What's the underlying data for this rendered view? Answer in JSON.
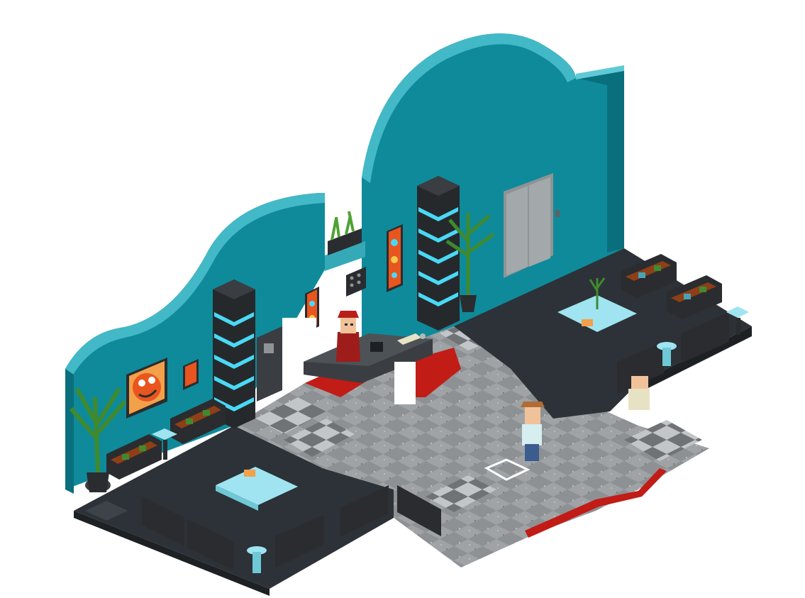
{
  "scene": {
    "type": "isometric-hotel-lobby",
    "background": "#ffffff",
    "colors": {
      "wall_teal": "#0f8a9a",
      "wall_teal_dark": "#0a6f7d",
      "wall_teal_light": "#43b8c6",
      "floor_dark": "#2c3237",
      "floor_marble": "#8d9194",
      "floor_marble_light": "#b4b7b9",
      "carpet_red": "#c21c16",
      "pillar_dark": "#26292c",
      "pillar_glow": "#49d9f5",
      "sofa_brown": "#8e3f17",
      "sofa_black": "#2a2c2f",
      "glass_table": "#9fe4f0",
      "elevator_grey": "#8e9396",
      "plant_green": "#3f8a2e"
    },
    "objects": [
      "left-lounge",
      "front-sofa-row",
      "marble-lobby-floor",
      "reception-desk",
      "receptionist-avatar",
      "player-avatar",
      "elevator-doors",
      "back-lounge",
      "light-pillars",
      "wall-paintings",
      "potted-plants",
      "red-carpet-trim",
      "smiley-painting"
    ],
    "icons": [
      "tile-selection-cursor"
    ]
  }
}
